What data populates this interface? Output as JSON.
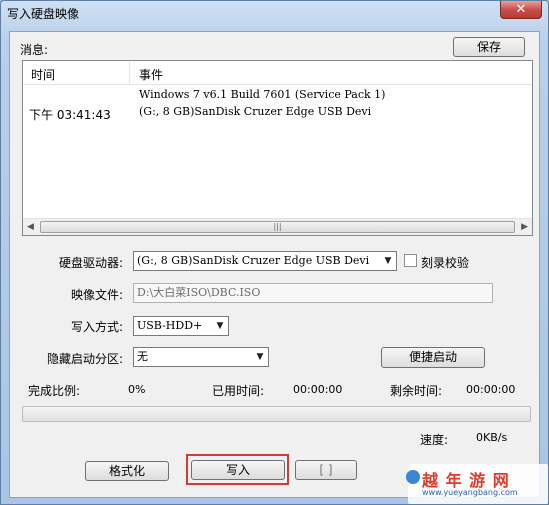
{
  "window": {
    "title": "写入硬盘映像",
    "close_glyph": "✕"
  },
  "messages": {
    "label": "消息:",
    "save_label": "保存",
    "columns": [
      "时间",
      "事件"
    ],
    "rows": [
      {
        "time": "",
        "event": "Windows 7 v6.1 Build 7601 (Service Pack 1)"
      },
      {
        "time": "下午 03:41:43",
        "event": "(G:, 8 GB)SanDisk Cruzer Edge USB Devi"
      }
    ]
  },
  "form": {
    "drive_label": "硬盘驱动器:",
    "drive_value": "(G:, 8 GB)SanDisk Cruzer Edge USB Devi",
    "verify_label": "刻录校验",
    "verify_checked": false,
    "image_label": "映像文件:",
    "image_value": "D:\\大白菜ISO\\DBC.ISO",
    "write_mode_label": "写入方式:",
    "write_mode_value": "USB-HDD+",
    "hidden_partition_label": "隐藏启动分区:",
    "hidden_partition_value": "无",
    "quick_boot_label": "便捷启动"
  },
  "status": {
    "complete_label": "完成比例:",
    "complete_value": "0%",
    "elapsed_label": "已用时间:",
    "elapsed_value": "00:00:00",
    "remaining_label": "剩余时间:",
    "remaining_value": "00:00:00",
    "progress": 0,
    "speed_label": "速度:",
    "speed_value": "0KB/s"
  },
  "buttons": {
    "format_label": "格式化",
    "write_label": "写入",
    "partial_label": "[ ]"
  },
  "watermark": {
    "logo_text": "越 年 游 网",
    "url_text": "www.yueyangbang.com"
  },
  "colors": {
    "highlight": "#d33b3b"
  }
}
